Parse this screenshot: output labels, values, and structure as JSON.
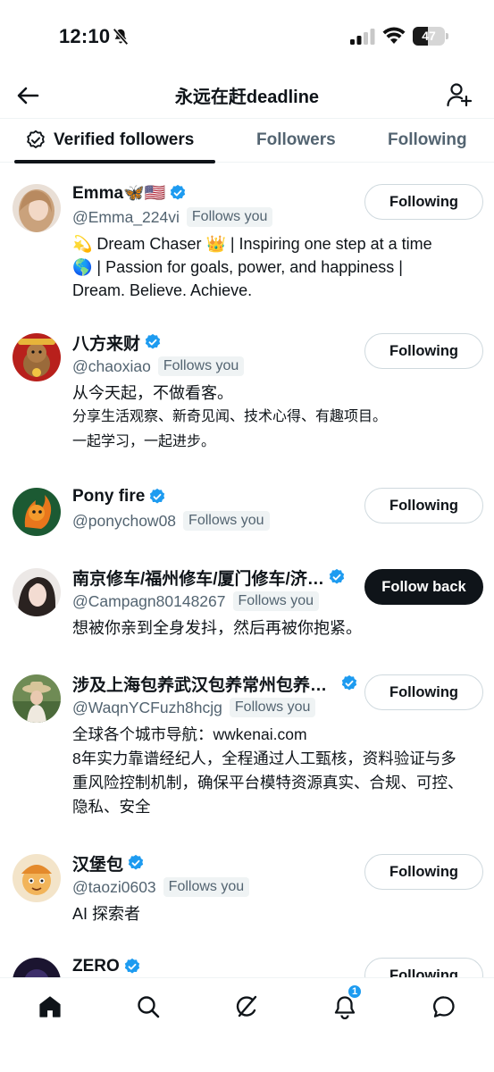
{
  "status_bar": {
    "time": "12:10",
    "battery": "47",
    "battery_level": 0.47
  },
  "header": {
    "title": "永远在赶deadline"
  },
  "tabs": [
    {
      "label": "Verified followers",
      "active": true
    },
    {
      "label": "Followers",
      "active": false
    },
    {
      "label": "Following",
      "active": false
    }
  ],
  "users": [
    {
      "name": "Emma🦋🇺🇸",
      "handle": "@Emma_224vi",
      "follows_you": "Follows you",
      "button": "Following",
      "bio": [
        "💫 Dream Chaser 👑 | Inspiring one step at a time",
        "🌎 | Passion for goals, power, and happiness |",
        "Dream. Believe. Achieve."
      ]
    },
    {
      "name": "八方来财",
      "handle": "@chaoxiao",
      "follows_you": "Follows you",
      "button": "Following",
      "bio": [
        "从今天起，不做看客。"
      ],
      "bio_small": [
        "分享生活观察、新奇见闻、技术心得、有趣项目。",
        "一起学习，一起进步。"
      ]
    },
    {
      "name": "Pony fire",
      "handle": "@ponychow08",
      "follows_you": "Follows you",
      "button": "Following",
      "bio": []
    },
    {
      "name": "南京修车/福州修车/厦门修车/济…",
      "handle": "@Campagn80148267",
      "follows_you": "Follows you",
      "button": "Follow back",
      "bio": [
        "想被你亲到全身发抖，然后再被你抱紧。"
      ]
    },
    {
      "name": "涉及上海包养武汉包养常州包养广…",
      "handle": "@WaqnYCFuzh8hcjg",
      "follows_you": "Follows you",
      "button": "Following",
      "bio": [
        "全球各个城市导航：wwkenai.com",
        "8年实力靠谱经纪人，全程通过人工甄核，资料验证与多",
        "重风险控制机制，确保平台模特资源真实、合规、可控、",
        "隐私、安全"
      ]
    },
    {
      "name": "汉堡包",
      "handle": "@taozi0603",
      "follows_you": "Follows you",
      "button": "Following",
      "bio": [
        "AI 探索者"
      ]
    },
    {
      "name": "ZERO",
      "button": "Following"
    }
  ],
  "bottom_nav": {
    "notifications_badge": "1"
  },
  "colors": {
    "verified_blue": "#1d9bf0",
    "text_primary": "#0f1419",
    "text_secondary": "#536471"
  }
}
